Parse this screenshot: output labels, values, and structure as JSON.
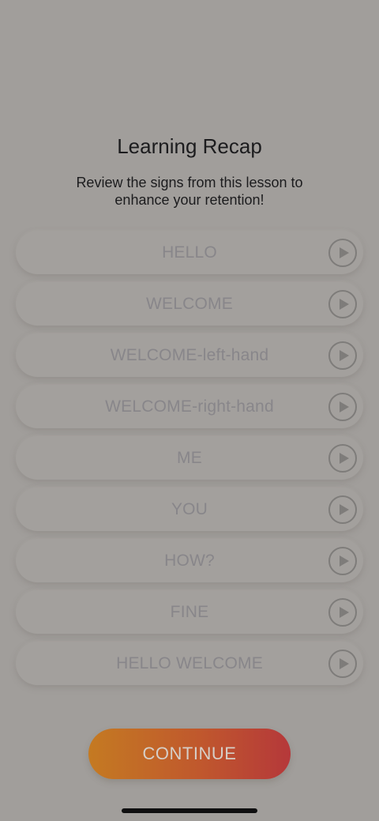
{
  "header": {
    "title": "Learning Recap",
    "subtitle": "Review the signs from this lesson to enhance your retention!"
  },
  "signs": [
    {
      "label": "HELLO",
      "icon": "play-circle-icon"
    },
    {
      "label": "WELCOME",
      "icon": "play-circle-icon"
    },
    {
      "label": "WELCOME-left-hand",
      "icon": "play-circle-icon"
    },
    {
      "label": "WELCOME-right-hand",
      "icon": "play-circle-icon"
    },
    {
      "label": "ME",
      "icon": "play-circle-icon"
    },
    {
      "label": "YOU",
      "icon": "play-circle-icon"
    },
    {
      "label": "HOW?",
      "icon": "play-circle-icon"
    },
    {
      "label": "FINE",
      "icon": "play-circle-icon"
    },
    {
      "label": "HELLO WELCOME",
      "icon": "play-circle-icon"
    }
  ],
  "footer": {
    "continue_label": "CONTINUE"
  },
  "colors": {
    "background": "#a19e9b",
    "accent_start": "#c47a22",
    "accent_end": "#b5383a"
  }
}
